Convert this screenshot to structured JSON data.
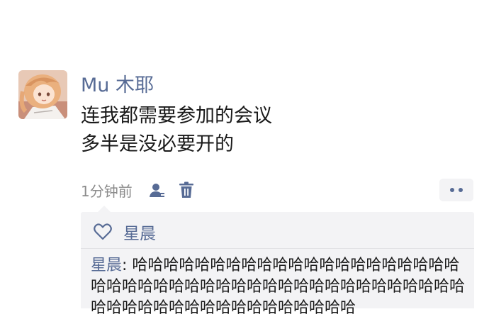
{
  "post": {
    "author": "Mu 木耶",
    "lines": [
      "连我都需要参加的会议",
      "多半是没必要开的"
    ],
    "timestamp": "1分钟前"
  },
  "icons": {
    "avatar": "anime-girl-avatar",
    "contact": "contact-visibility-icon",
    "delete": "trash-icon",
    "more": "more-dots-icon",
    "like": "heart-outline-icon"
  },
  "likes": {
    "names": "星晨"
  },
  "comments": [
    {
      "author": "星晨",
      "separator": ": ",
      "text": "哈哈哈哈哈哈哈哈哈哈哈哈哈哈哈哈哈哈哈哈哈哈哈哈哈哈哈哈哈哈哈哈哈哈哈哈哈哈哈哈哈哈哈哈哈哈哈哈哈哈哈哈哈哈哈哈哈哈哈哈哈哈"
    }
  ],
  "colors": {
    "link": "#576b95",
    "text": "#1a1a1a",
    "muted": "#8c8c8c",
    "panel": "#f3f3f5"
  }
}
